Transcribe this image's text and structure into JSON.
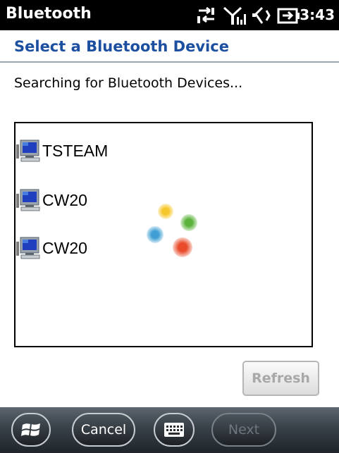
{
  "statusbar": {
    "app_title": "Bluetooth",
    "time": "3:43",
    "icons": [
      "data-sync-icon",
      "signal-icon",
      "speaker-icon",
      "battery-charging-icon"
    ]
  },
  "header": {
    "title": "Select a Bluetooth Device"
  },
  "status_text": "Searching for Bluetooth Devices...",
  "devices": [
    {
      "name": "TSTEAM",
      "icon": "computer-icon"
    },
    {
      "name": "CW20",
      "icon": "computer-icon"
    },
    {
      "name": "CW20",
      "icon": "computer-icon"
    }
  ],
  "spinner": {
    "icon": "loading-spinner-icon",
    "colors": [
      "#f5c72a",
      "#5cb33c",
      "#3f9ed3",
      "#e84a2a"
    ]
  },
  "buttons": {
    "refresh": "Refresh"
  },
  "bottombar": {
    "cancel": "Cancel",
    "next": "Next",
    "icons": [
      "windows-start-icon",
      "keyboard-icon"
    ]
  },
  "colors": {
    "header_title": "#1c4fa0",
    "statusbar_bg": "#000000",
    "disabled_text": "#a8a8a8"
  }
}
